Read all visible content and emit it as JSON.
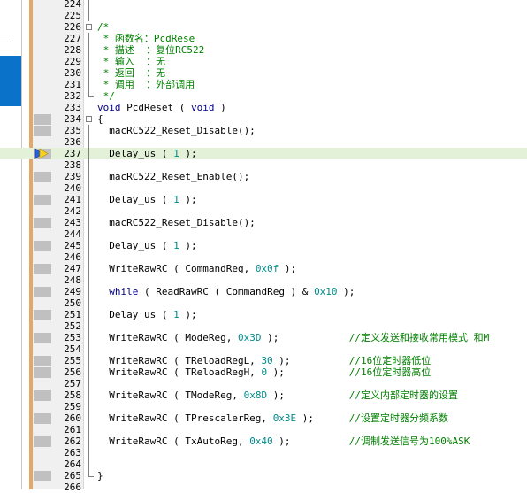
{
  "editor": {
    "lines": [
      {
        "n": "224",
        "code": ""
      },
      {
        "n": "225",
        "code": ""
      },
      {
        "n": "226",
        "code": "/*"
      },
      {
        "n": "227",
        "code": " * 函数名：PcdRese"
      },
      {
        "n": "228",
        "code": " * 描述  ：复位RC522"
      },
      {
        "n": "229",
        "code": " * 输入  ：无"
      },
      {
        "n": "230",
        "code": " * 返回  ：无"
      },
      {
        "n": "231",
        "code": " * 调用  ：外部调用"
      },
      {
        "n": "232",
        "code": " */"
      },
      {
        "n": "233",
        "code": "void PcdReset ( void )"
      },
      {
        "n": "234",
        "code": "{"
      },
      {
        "n": "235",
        "code": "  macRC522_Reset_Disable();"
      },
      {
        "n": "236",
        "code": ""
      },
      {
        "n": "237",
        "code": "  Delay_us ( 1 );"
      },
      {
        "n": "238",
        "code": ""
      },
      {
        "n": "239",
        "code": "  macRC522_Reset_Enable();"
      },
      {
        "n": "240",
        "code": ""
      },
      {
        "n": "241",
        "code": "  Delay_us ( 1 );"
      },
      {
        "n": "242",
        "code": ""
      },
      {
        "n": "243",
        "code": "  macRC522_Reset_Disable();"
      },
      {
        "n": "244",
        "code": ""
      },
      {
        "n": "245",
        "code": "  Delay_us ( 1 );"
      },
      {
        "n": "246",
        "code": ""
      },
      {
        "n": "247",
        "code": "  WriteRawRC ( CommandReg, 0x0f );"
      },
      {
        "n": "248",
        "code": ""
      },
      {
        "n": "249",
        "code": "  while ( ReadRawRC ( CommandReg ) & 0x10 );"
      },
      {
        "n": "250",
        "code": ""
      },
      {
        "n": "251",
        "code": "  Delay_us ( 1 );"
      },
      {
        "n": "252",
        "code": ""
      },
      {
        "n": "253",
        "code": "  WriteRawRC ( ModeReg, 0x3D );            //定义发送和接收常用模式 和M"
      },
      {
        "n": "254",
        "code": ""
      },
      {
        "n": "255",
        "code": "  WriteRawRC ( TReloadRegL, 30 );          //16位定时器低位"
      },
      {
        "n": "256",
        "code": "  WriteRawRC ( TReloadRegH, 0 );           //16位定时器高位"
      },
      {
        "n": "257",
        "code": ""
      },
      {
        "n": "258",
        "code": "  WriteRawRC ( TModeReg, 0x8D );           //定义内部定时器的设置"
      },
      {
        "n": "259",
        "code": ""
      },
      {
        "n": "260",
        "code": "  WriteRawRC ( TPrescalerReg, 0x3E );      //设置定时器分频系数"
      },
      {
        "n": "261",
        "code": ""
      },
      {
        "n": "262",
        "code": "  WriteRawRC ( TxAutoReg, 0x40 );          //调制发送信号为100%ASK"
      },
      {
        "n": "263",
        "code": ""
      },
      {
        "n": "264",
        "code": ""
      },
      {
        "n": "265",
        "code": "}"
      },
      {
        "n": "266",
        "code": ""
      }
    ],
    "current_line": "237",
    "colors": {
      "comment": "#008000",
      "keyword": "#00008b",
      "number": "#008b8b",
      "current_line_bg": "#e2f1d8"
    },
    "icons": {
      "current_line_marker": "execution-arrow-icon"
    }
  }
}
